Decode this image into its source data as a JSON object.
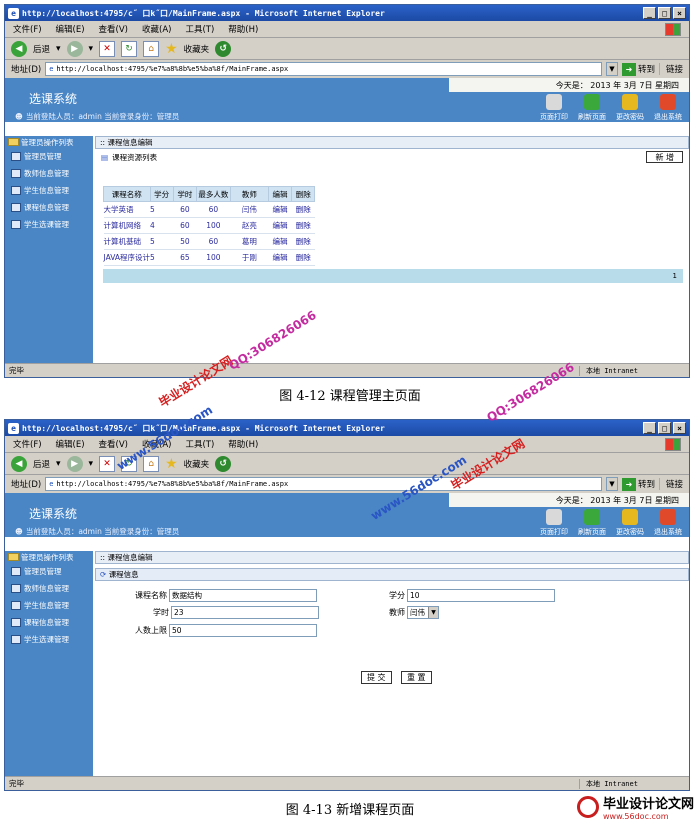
{
  "browser": {
    "title": "http://localhost:4795/c˝ 口k˝口/MainFrame.aspx - Microsoft Internet Explorer",
    "menu": [
      "文件(F)",
      "编辑(E)",
      "查看(V)",
      "收藏(A)",
      "工具(T)",
      "帮助(H)"
    ],
    "back": "后退",
    "favorites": "收藏夹",
    "address_label": "地址(D)",
    "address": "http://localhost:4795/%e7%a8%8b%e5%ba%8f/MainFrame.aspx",
    "go": "转到",
    "links": "链接",
    "status": "完毕",
    "zone": "本地 Intranet",
    "win_buttons": [
      "_",
      "□",
      "×"
    ]
  },
  "app": {
    "system_name": "选课系统",
    "today": "今天是： 2013 年 3月 7日 星期四",
    "user_info": "当前登陆人员：admin 当前登录身份：管理员",
    "actions": [
      {
        "label": "页面打印",
        "icon": "printer-icon",
        "color": "#d9d9d9"
      },
      {
        "label": "刷新页面",
        "icon": "refresh-icon",
        "color": "#3aa83a"
      },
      {
        "label": "更改密码",
        "icon": "key-icon",
        "color": "#e6b820"
      },
      {
        "label": "退出系统",
        "icon": "power-icon",
        "color": "#e04a2a"
      }
    ],
    "sidebar_head": "管理员操作列表",
    "sidebar": [
      "管理员管理",
      "教师信息管理",
      "学生信息管理",
      "课程信息管理",
      "学生选课管理"
    ],
    "section_title": ":: 课程信息编辑"
  },
  "screen1": {
    "list_title": "课程资源列表",
    "new_button": "新 增",
    "columns": [
      "课程名称",
      "学分",
      "学时",
      "最多人数",
      "教师",
      "编辑",
      "删除"
    ],
    "rows": [
      [
        "大学英语",
        "5",
        "60",
        "60",
        "闫伟",
        "编辑",
        "删除"
      ],
      [
        "计算机网络",
        "4",
        "60",
        "100",
        "赵亮",
        "编辑",
        "删除"
      ],
      [
        "计算机基础",
        "5",
        "50",
        "60",
        "葛明",
        "编辑",
        "删除"
      ],
      [
        "JAVA程序设计",
        "5",
        "65",
        "100",
        "于刚",
        "编辑",
        "删除"
      ]
    ],
    "page": "1",
    "caption": "图 4-12 课程管理主页面"
  },
  "screen2": {
    "section_title": "课程信息编辑",
    "form_title": "课程信息",
    "fields": {
      "name_label": "课程名称",
      "name_value": "数据结构",
      "credit_label": "学分",
      "credit_value": "10",
      "hours_label": "学时",
      "hours_value": "23",
      "teacher_label": "教师",
      "teacher_value": "闫伟",
      "limit_label": "人数上限",
      "limit_value": "50"
    },
    "submit": "提 交",
    "reset": "重 置",
    "caption": "图 4-13  新增课程页面"
  },
  "watermarks": {
    "site_cn": "毕业设计论文网",
    "site_url": "www.56doc.com",
    "qq": "QQ:306826066"
  },
  "logo": {
    "text": "毕业设计论文网",
    "url": "www.56doc.com"
  }
}
